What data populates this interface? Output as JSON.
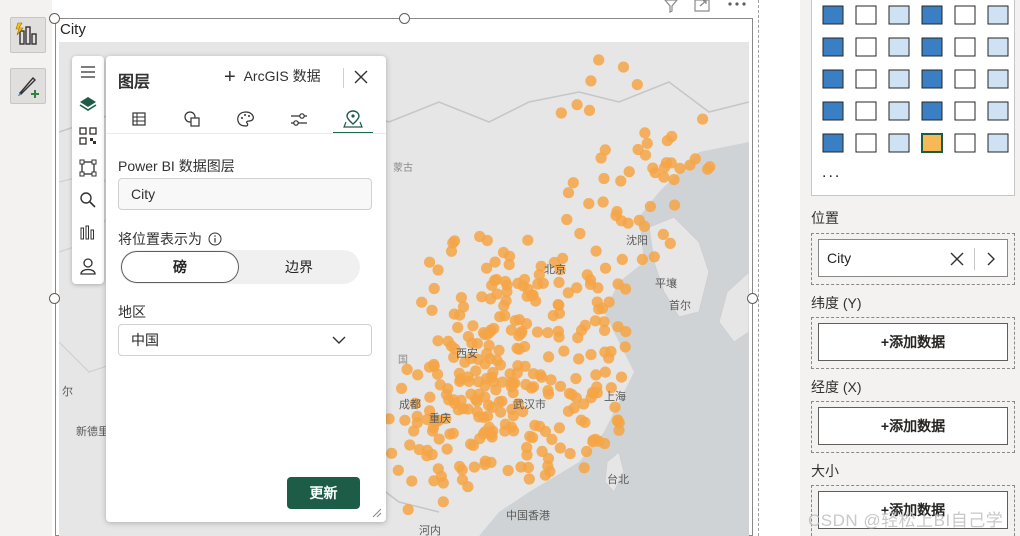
{
  "visual": {
    "title": "City"
  },
  "map": {
    "labels": [
      {
        "text": "蒙古",
        "minor": true
      },
      {
        "text": "沈阳",
        "minor": false
      },
      {
        "text": "北京",
        "minor": false
      },
      {
        "text": "平壤",
        "minor": false
      },
      {
        "text": "首尔",
        "minor": false
      },
      {
        "text": "西安",
        "minor": false
      },
      {
        "text": "成都",
        "minor": false
      },
      {
        "text": "重庆",
        "minor": false
      },
      {
        "text": "武汉市",
        "minor": false
      },
      {
        "text": "上海",
        "minor": false
      },
      {
        "text": "台北",
        "minor": false
      },
      {
        "text": "中国香港",
        "minor": false
      },
      {
        "text": "河内",
        "minor": false
      },
      {
        "text": "新德里",
        "minor": false
      },
      {
        "text": "尔",
        "minor": false
      },
      {
        "text": "国",
        "minor": true
      }
    ],
    "dot_color": "#f5a445",
    "base_color": "#e4e4e4"
  },
  "toolbar": {
    "items": [
      "menu-icon",
      "layers-icon",
      "qr-icon",
      "select-rect-icon",
      "search-icon",
      "chart-icon",
      "user-icon"
    ]
  },
  "panel": {
    "title": "图层",
    "arcgis_add": "ArcGIS 数据",
    "tabs": [
      "table-icon",
      "shapes-icon",
      "palette-icon",
      "sliders-icon",
      "location-icon"
    ],
    "active_tab": 4,
    "layer_label": "Power BI 数据图层",
    "layer_name": "City",
    "represent_label": "将位置表示为",
    "represent_options": [
      "磅",
      "边界"
    ],
    "represent_selected": "磅",
    "region_label": "地区",
    "region_value": "中国",
    "update_button": "更新"
  },
  "fields": {
    "location_label": "位置",
    "location_value": "City",
    "latitude_label": "纬度 (Y)",
    "latitude_add": "+添加数据",
    "longitude_label": "经度 (X)",
    "longitude_add": "+添加数据",
    "size_label": "大小",
    "size_add": "+添加数据"
  },
  "gallery": {
    "more": "..."
  },
  "watermark": "CSDN @轻松上BI自己学",
  "colors": {
    "accent": "#1d5c46",
    "dots": "#f5a445",
    "pbi_yellow": "#f2c811"
  }
}
